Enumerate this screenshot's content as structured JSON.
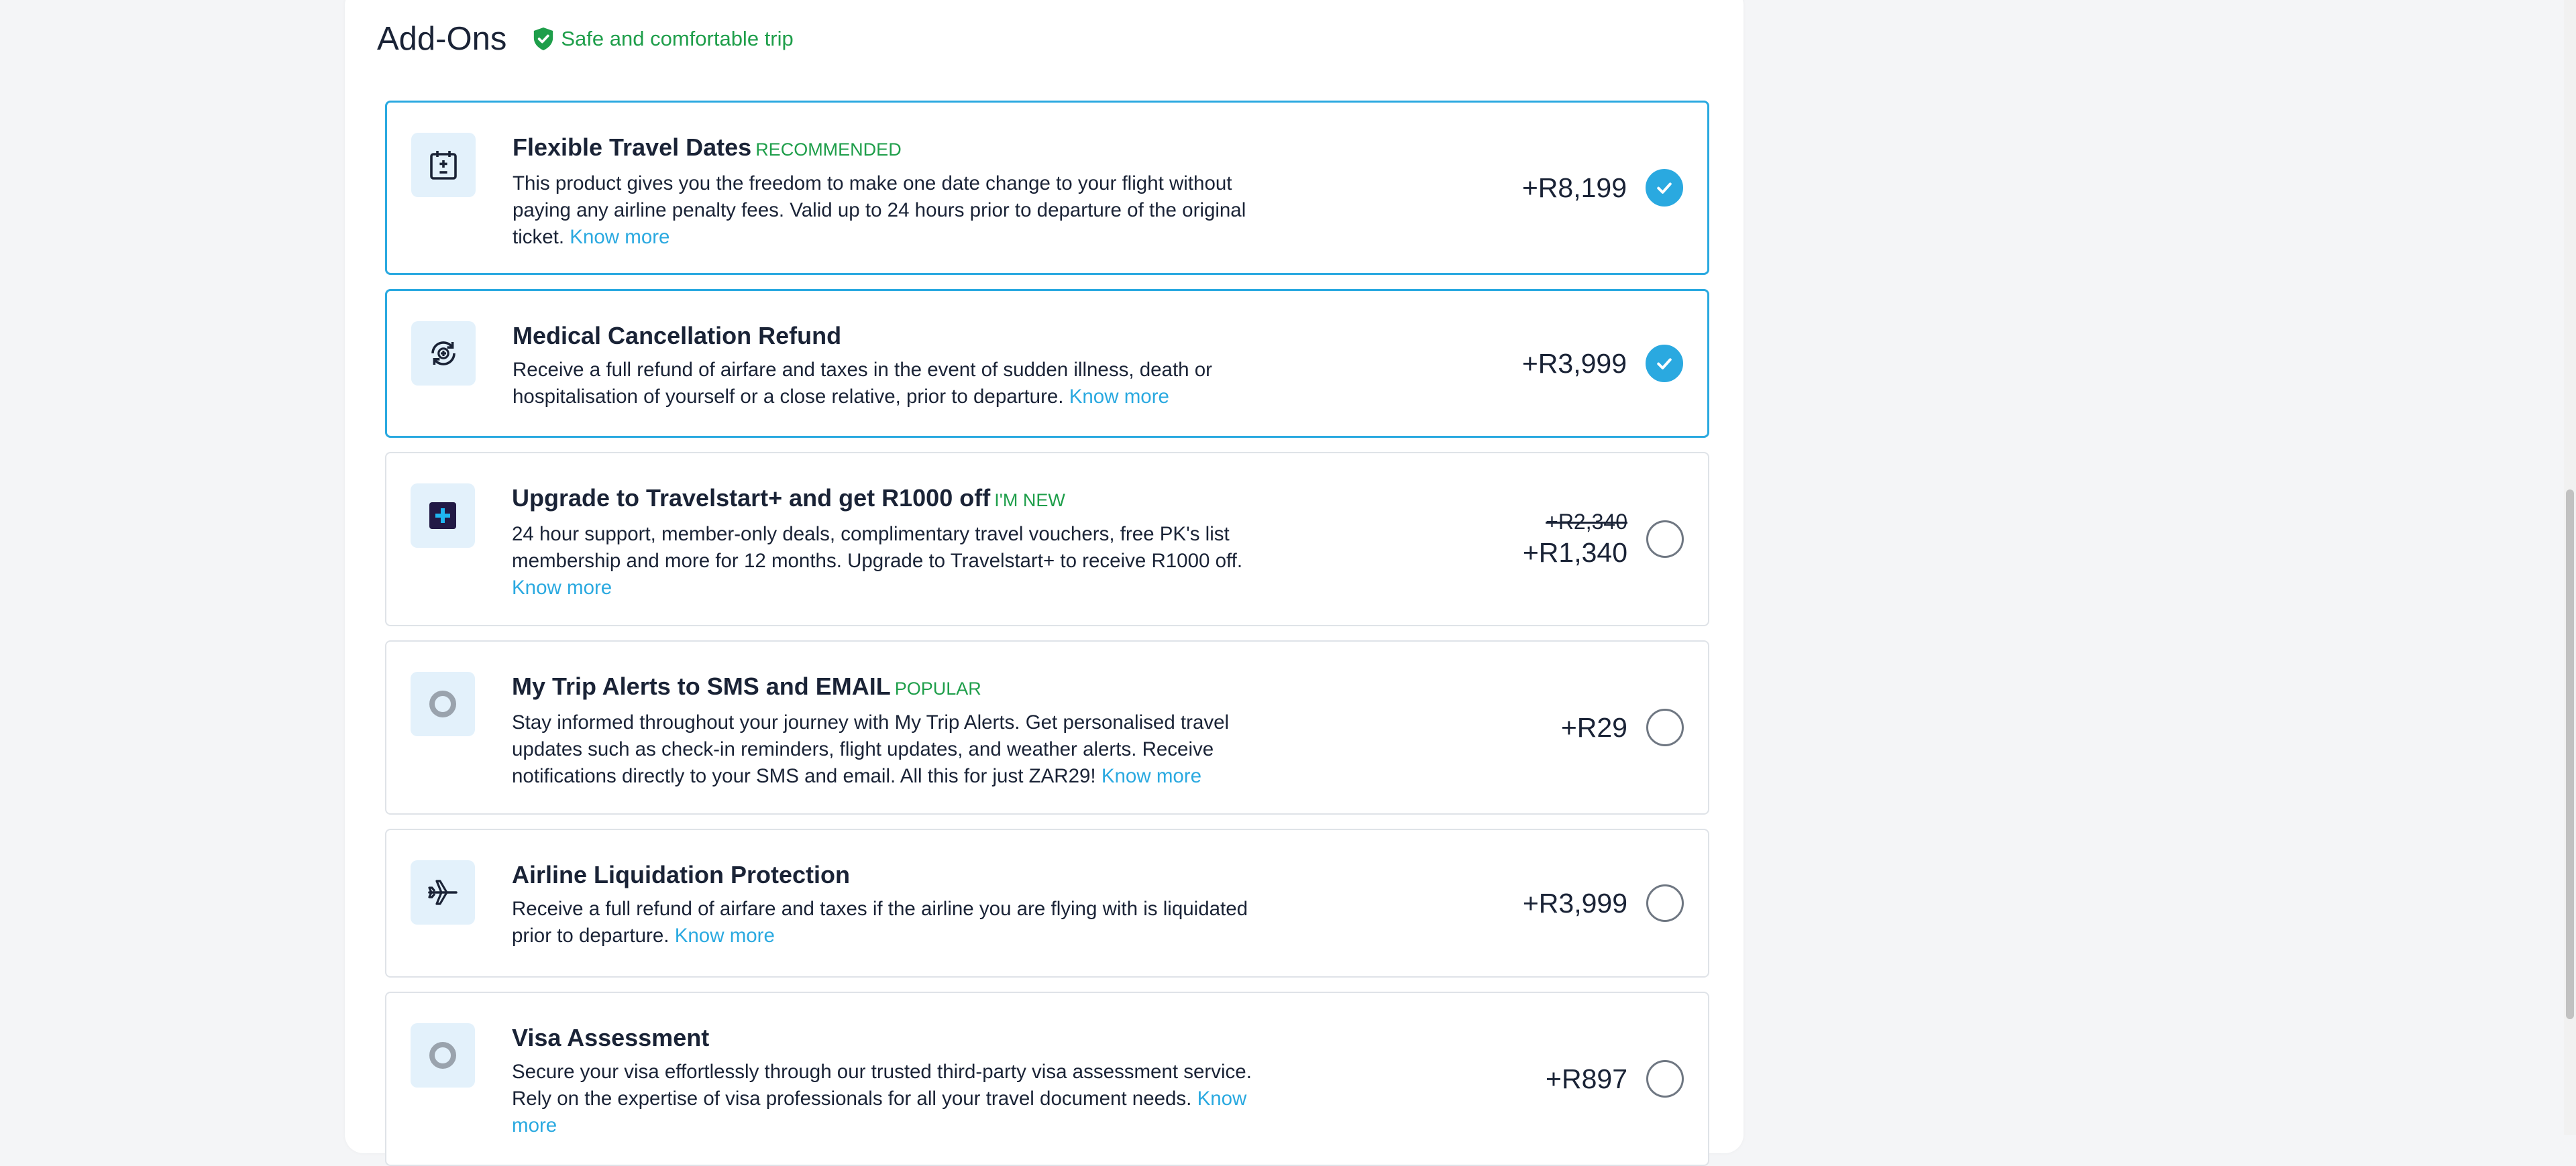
{
  "header": {
    "title": "Add-Ons",
    "safe_text": "Safe and comfortable trip"
  },
  "addons": [
    {
      "name": "Flexible Travel Dates",
      "badge": "RECOMMENDED",
      "description": "This product gives you the freedom to make one date change to your flight without paying any airline penalty fees. Valid up to 24 hours prior to departure of the original ticket.",
      "link": "Know more",
      "price": "+R8,199",
      "selected": true,
      "icon": "calendar-plus-minus-icon"
    },
    {
      "name": "Medical Cancellation Refund",
      "badge": "",
      "description": "Receive a full refund of airfare and taxes in the event of sudden illness, death or hospitalisation of yourself or a close relative, prior to departure.",
      "link": "Know more",
      "price": "+R3,999",
      "selected": true,
      "icon": "medical-refund-icon"
    },
    {
      "name": "Upgrade to Travelstart+ and get R1000 off",
      "badge": "I'M NEW",
      "description": "24 hour support, member-only deals, complimentary travel vouchers, free PK's list membership and more for 12 months. Upgrade to Travelstart+ to receive R1000 off.",
      "link": "Know more",
      "old_price": "+R2,340",
      "price": "+R1,340",
      "selected": false,
      "icon": "travelstart-plus-icon"
    },
    {
      "name": "My Trip Alerts to SMS and EMAIL",
      "badge": "POPULAR",
      "description": "Stay informed throughout your journey with My Trip Alerts. Get personalised travel updates such as check-in reminders, flight updates, and weather alerts. Receive notifications directly to your SMS and email. All this for just ZAR29!",
      "link": "Know more",
      "price": "+R29",
      "selected": false,
      "icon": "ring-placeholder-icon"
    },
    {
      "name": "Airline Liquidation Protection",
      "badge": "",
      "description": "Receive a full refund of airfare and taxes if the airline you are flying with is liquidated prior to departure.",
      "link": "Know more",
      "price": "+R3,999",
      "selected": false,
      "icon": "airplane-icon"
    },
    {
      "name": "Visa Assessment",
      "badge": "",
      "description": "Secure your visa effortlessly through our trusted third-party visa assessment service. Rely on the expertise of visa professionals for all your travel document needs.",
      "link": "Know more",
      "price": "+R897",
      "selected": false,
      "icon": "ring-placeholder-icon"
    }
  ],
  "colors": {
    "accent": "#2aa9e0",
    "badge_green": "#1e9e4a",
    "text": "#1a2336"
  }
}
